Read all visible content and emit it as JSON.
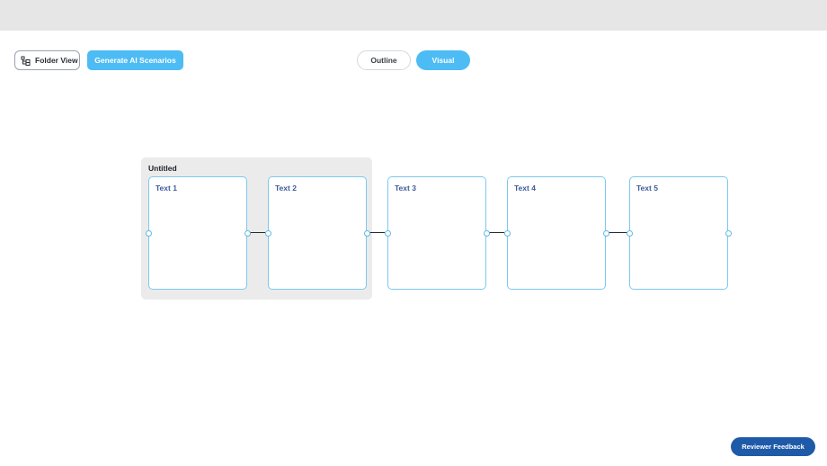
{
  "toolbar": {
    "folder_view_label": "Folder View",
    "folder_view_icon": "folder-tree-icon",
    "generate_label": "Generate AI Scenarios"
  },
  "view_toggle": {
    "outline_label": "Outline",
    "visual_label": "Visual",
    "active": "Visual"
  },
  "canvas": {
    "group": {
      "title": "Untitled"
    },
    "cards": [
      {
        "title": "Text 1"
      },
      {
        "title": "Text 2"
      },
      {
        "title": "Text 3"
      },
      {
        "title": "Text 4"
      },
      {
        "title": "Text 5"
      }
    ]
  },
  "footer": {
    "feedback_label": "Reviewer Feedback"
  },
  "colors": {
    "accent": "#4dbcf5",
    "card_border": "#7cc9ee",
    "card_title": "#3d5a9a",
    "group_bg": "#ebebeb",
    "feedback_bg": "#1f5aa8",
    "topbar_bg": "#e6e6e6"
  }
}
